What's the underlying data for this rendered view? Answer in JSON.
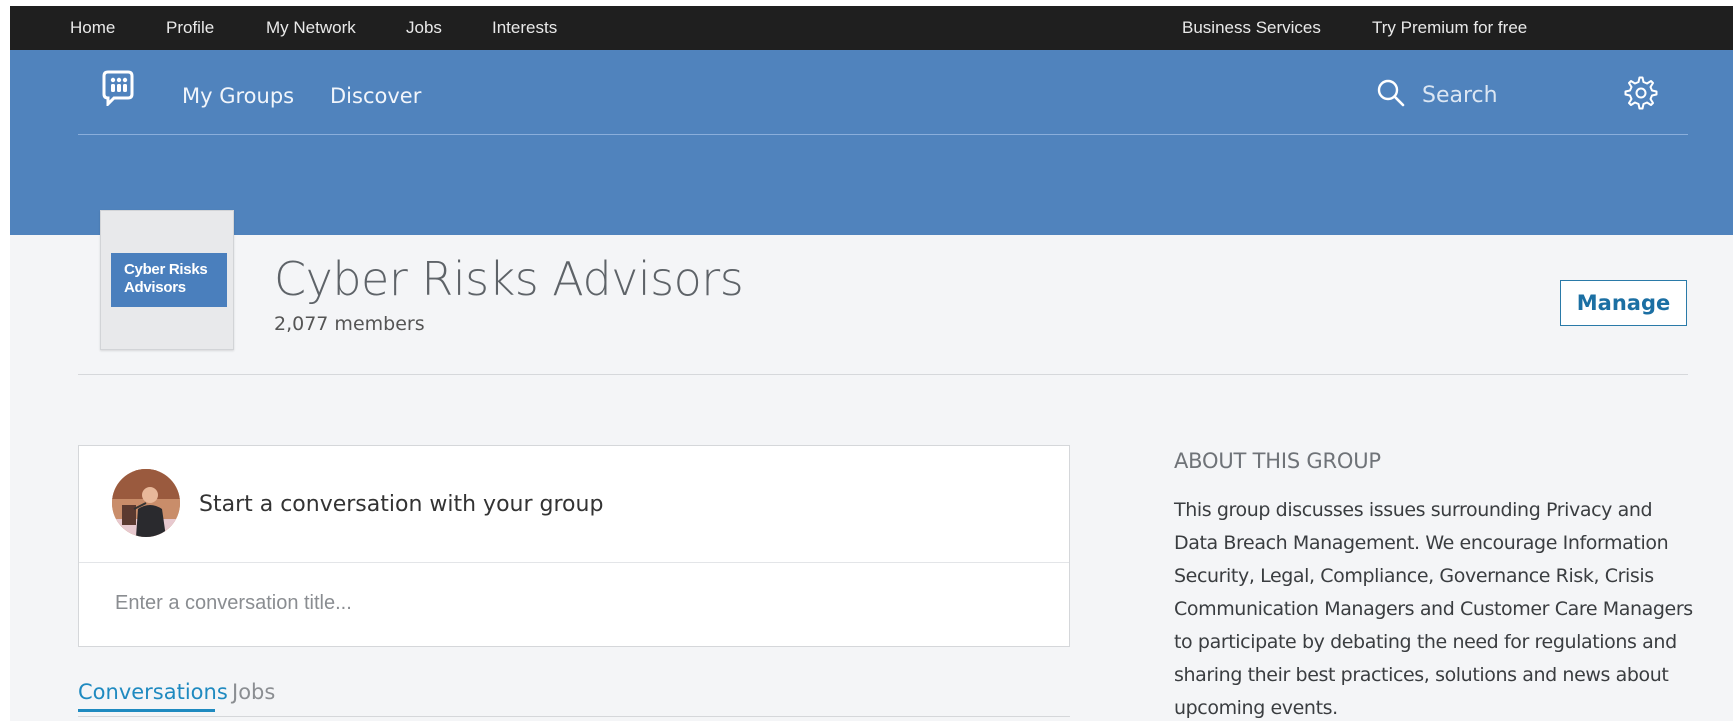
{
  "topbar": {
    "items": [
      "Home",
      "Profile",
      "My Network",
      "Jobs",
      "Interests"
    ],
    "business_services": "Business Services",
    "premium": "Try Premium for free"
  },
  "subnav": {
    "logo_icon": "groups-chat-icon",
    "my_groups": "My Groups",
    "discover": "Discover",
    "search_placeholder": "Search",
    "settings_icon": "gear-icon"
  },
  "group": {
    "logo_text_line1": "Cyber Risks",
    "logo_text_line2": "Advisors",
    "title": "Cyber Risks Advisors",
    "members": "2,077 members",
    "manage_label": "Manage"
  },
  "composer": {
    "prompt": "Start a conversation with your group",
    "title_placeholder": "Enter a conversation title..."
  },
  "tabs": [
    {
      "label": "Conversations",
      "active": true
    },
    {
      "label": "Jobs",
      "active": false
    }
  ],
  "about": {
    "heading": "ABOUT THIS GROUP",
    "text": "This group discusses issues surrounding Privacy and Data Breach Management. We encourage Information Security, Legal, Compliance, Governance Risk, Crisis Communication Managers and Customer Care Managers to participate by debating the need for regulations and sharing their best practices, solutions and news about upcoming events."
  },
  "colors": {
    "topbar_bg": "#1f1f1f",
    "header_blue": "#5083bd",
    "accent": "#1f8ac0",
    "page_bg": "#f4f5f7"
  }
}
